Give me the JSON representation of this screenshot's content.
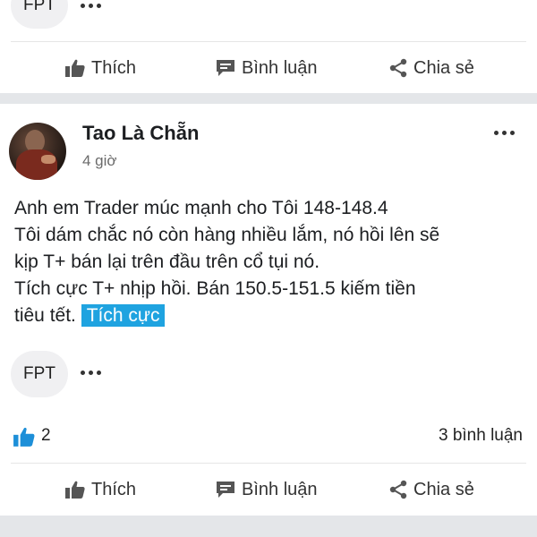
{
  "top_post": {
    "tag_chip": "FPT",
    "actions": {
      "like": "Thích",
      "comment": "Bình luận",
      "share": "Chia sẻ"
    }
  },
  "post": {
    "author": "Tao Là Chẵn",
    "time": "4 giờ",
    "lines": [
      "Anh em Trader múc mạnh cho Tôi 148-148.4",
      "Tôi dám chắc nó còn hàng nhiều lắm, nó hồi lên sẽ",
      "kịp T+ bán lại trên đầu trên cổ tụi nó.",
      "Tích cực T+ nhịp hồi. Bán 150.5-151.5 kiếm tiền",
      "tiêu tết."
    ],
    "sentiment_tag": "Tích cực",
    "tag_chip": "FPT",
    "like_count": "2",
    "comment_count": "3 bình luận",
    "actions": {
      "like": "Thích",
      "comment": "Bình luận",
      "share": "Chia sẻ"
    }
  },
  "colors": {
    "accent": "#1fa3e0",
    "like_blue": "#1d8fd8",
    "divider": "#e4e6e9"
  }
}
